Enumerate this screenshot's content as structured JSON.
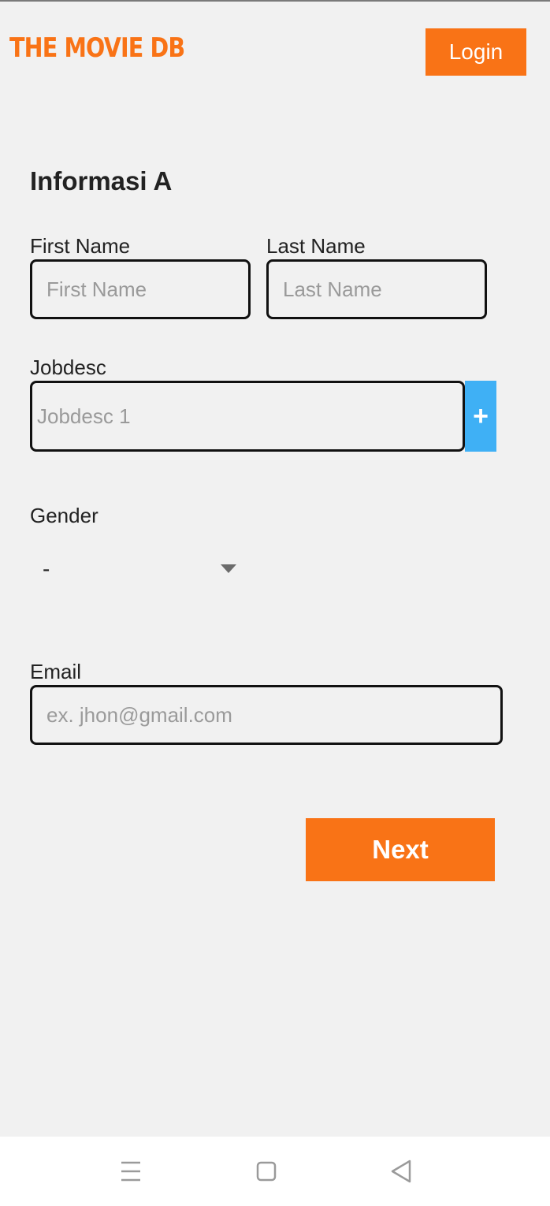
{
  "app": {
    "logo_text": "THE MOVIE DB",
    "login_label": "Login",
    "brand_color": "#f97316",
    "accent_color": "#3fb0f5"
  },
  "form": {
    "section_title": "Informasi A",
    "first_name": {
      "label": "First Name",
      "placeholder": "First Name",
      "value": ""
    },
    "last_name": {
      "label": "Last Name",
      "placeholder": "Last Name",
      "value": ""
    },
    "jobdesc": {
      "label": "Jobdesc",
      "placeholder": "Jobdesc 1",
      "value": "",
      "add_label": "+"
    },
    "gender": {
      "label": "Gender",
      "selected": "-"
    },
    "email": {
      "label": "Email",
      "placeholder": "ex. jhon@gmail.com",
      "value": ""
    },
    "next_label": "Next"
  },
  "system_nav": {
    "icons": [
      "menu-icon",
      "home-square-icon",
      "back-triangle-icon"
    ]
  }
}
